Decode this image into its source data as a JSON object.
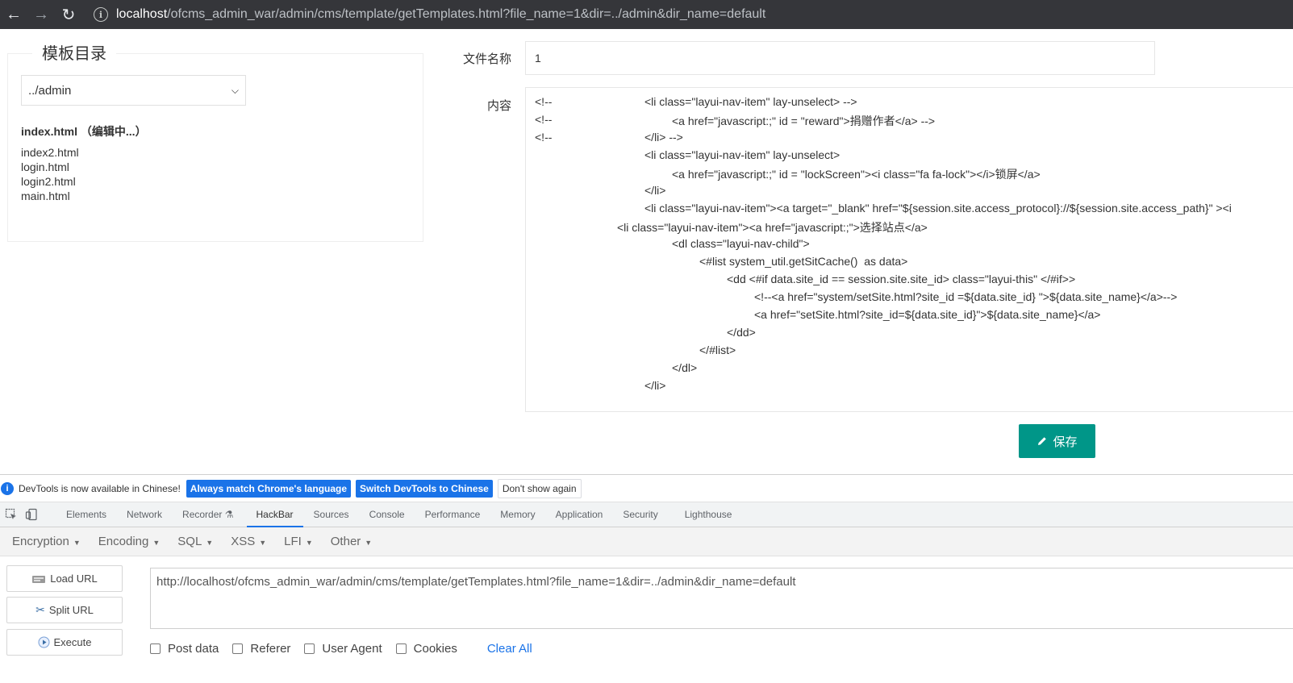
{
  "browser": {
    "url_host": "localhost",
    "url_path": "/ofcms_admin_war/admin/cms/template/getTemplates.html?file_name=1&dir=../admin&dir_name=default"
  },
  "template_panel": {
    "legend": "模板目录",
    "dir_select": "../admin",
    "current_file": "index.html （编辑中...）",
    "files": [
      "index2.html",
      "login.html",
      "login2.html",
      "main.html"
    ]
  },
  "form": {
    "file_name_label": "文件名称",
    "file_name_value": "1",
    "content_label": "内容",
    "content_lines": [
      "<!--",
      "<!--",
      "<!--",
      "<li class=\"layui-nav-item\" lay-unselect> -->",
      "<a href=\"javascript:;\" id = \"reward\">捐赠作者</a> -->",
      "</li> -->",
      "<li class=\"layui-nav-item\" lay-unselect>",
      "<a href=\"javascript:;\" id = \"lockScreen\"><i class=\"fa fa-lock\"></i>锁屏</a>",
      "</li>",
      "<li class=\"layui-nav-item\"><a target=\"_blank\" href=\"${session.site.access_protocol}://${session.site.access_path}\" ><i",
      "<li class=\"layui-nav-item\"><a href=\"javascript:;\">选择站点</a>",
      "<dl class=\"layui-nav-child\">",
      "<#list system_util.getSitCache()  as data>",
      "<dd <#if data.site_id == session.site.site_id> class=\"layui-this\" </#if>>",
      "<!--<a href=\"system/setSite.html?site_id =${data.site_id} \">${data.site_name}</a>-->",
      "<a href=\"setSite.html?site_id=${data.site_id}\">${data.site_name}</a>",
      "</dd>",
      "</#list>",
      "</dl>",
      "</li>"
    ],
    "save_label": "保存"
  },
  "devtools": {
    "notice_text": "DevTools is now available in Chinese!",
    "btn_match": "Always match Chrome's language",
    "btn_switch": "Switch DevTools to Chinese",
    "btn_dismiss": "Don't show again",
    "tabs": [
      "Elements",
      "Network",
      "Recorder",
      "HackBar",
      "Sources",
      "Console",
      "Performance",
      "Memory",
      "Application",
      "Security",
      "Lighthouse"
    ],
    "active_tab": "HackBar"
  },
  "hackbar": {
    "menu": [
      "Encryption",
      "Encoding",
      "SQL",
      "XSS",
      "LFI",
      "Other"
    ],
    "load_url": "Load URL",
    "split_url": "Split URL",
    "execute": "Execute",
    "url_value": "http://localhost/ofcms_admin_war/admin/cms/template/getTemplates.html?file_name=1&dir=../admin&dir_name=default",
    "options": [
      "Post data",
      "Referer",
      "User Agent",
      "Cookies"
    ],
    "clear_all": "Clear All"
  }
}
